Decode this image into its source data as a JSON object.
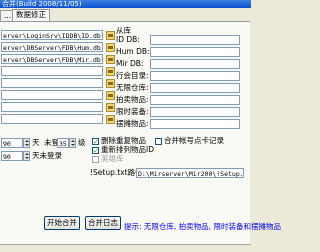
{
  "window": {
    "title": "合并(Build 2008/11/05)"
  },
  "tabs": [
    {
      "label": "..."
    },
    {
      "label": "数据修正"
    }
  ],
  "main_db": {
    "paths": [
      "erver\\LoginSrv\\IDDB\\ID.db",
      "erver\\DBServer\\FDB\\Hum.db",
      "erver\\DBServer\\FDB\\Mir.db",
      "",
      "",
      "",
      "",
      "",
      "",
      "",
      ""
    ]
  },
  "secondary_db": {
    "header": "从库",
    "fields": [
      {
        "label": "ID DB:",
        "value": ""
      },
      {
        "label": "Hum DB:",
        "value": ""
      },
      {
        "label": "Mir DB:",
        "value": ""
      },
      {
        "label": "行会目录:",
        "value": ""
      },
      {
        "label": "无限仓库:",
        "value": ""
      },
      {
        "label": "拍卖物品:",
        "value": ""
      },
      {
        "label": "限时装备:",
        "value": ""
      },
      {
        "label": "摆摊物品:",
        "value": ""
      }
    ]
  },
  "options": {
    "level_value": "90",
    "level_suffix": "天",
    "login_label": "未登",
    "login_value": "35",
    "login_suffix": "级",
    "days_value": "90",
    "days_suffix": "天未登录",
    "delete_dup_items": "删除重复物品",
    "renumber_items": "重新排列物品ID",
    "ads_label": "英雄库",
    "merge_account_label": "合并帐号点卡记录",
    "setup_label": "!Setup.txt路径",
    "setup_value": "D:\\Mirserver\\Mir200\\!Setup.txt"
  },
  "buttons": {
    "start": "开始合并",
    "log": "合并日志"
  },
  "hint": "提示: 无限仓库, 拍卖物品, 限时装备和摆摊物品"
}
